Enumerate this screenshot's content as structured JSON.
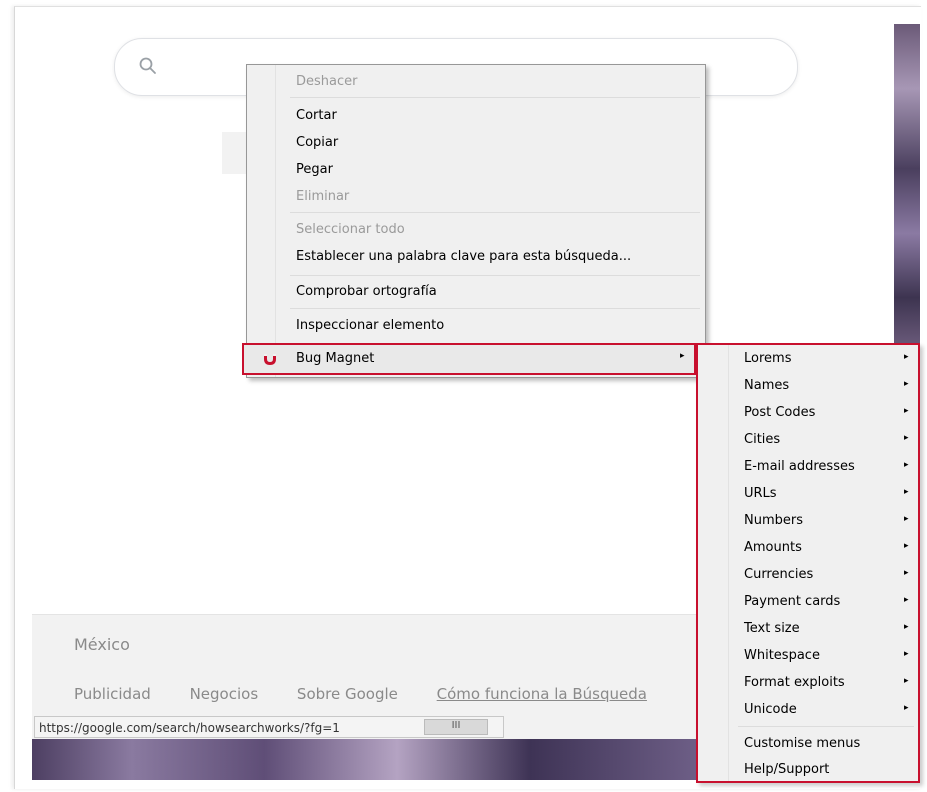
{
  "browser": {
    "status_url": "https://google.com/search/howsearchworks/?fg=1",
    "status_scroll_glyph": "III"
  },
  "google": {
    "footer_country": "México",
    "footer_links": [
      "Publicidad",
      "Negocios",
      "Sobre Google",
      "Cómo funciona la Búsqueda"
    ]
  },
  "context_menu": {
    "items": [
      {
        "label": "Deshacer",
        "enabled": false
      },
      {
        "label": "Cortar",
        "enabled": true
      },
      {
        "label": "Copiar",
        "enabled": true
      },
      {
        "label": "Pegar",
        "enabled": true
      },
      {
        "label": "Eliminar",
        "enabled": false
      },
      {
        "label": "Seleccionar todo",
        "enabled": false
      },
      {
        "label": "Establecer una palabra clave para esta búsqueda...",
        "enabled": true
      },
      {
        "label": "Comprobar ortografía",
        "enabled": true
      },
      {
        "label": "Inspeccionar elemento",
        "enabled": true
      }
    ],
    "extension": {
      "label": "Bug Magnet",
      "icon": "magnet-icon",
      "highlight_color": "#c8102e"
    }
  },
  "submenu": {
    "items": [
      {
        "label": "Lorems"
      },
      {
        "label": "Names"
      },
      {
        "label": "Post Codes"
      },
      {
        "label": "Cities"
      },
      {
        "label": "E-mail addresses"
      },
      {
        "label": "URLs"
      },
      {
        "label": "Numbers"
      },
      {
        "label": "Amounts"
      },
      {
        "label": "Currencies"
      },
      {
        "label": "Payment cards"
      },
      {
        "label": "Text size"
      },
      {
        "label": "Whitespace"
      },
      {
        "label": "Format exploits"
      },
      {
        "label": "Unicode"
      }
    ],
    "footer_items": [
      {
        "label": "Customise menus"
      },
      {
        "label": "Help/Support"
      }
    ],
    "arrow_glyph": "▸"
  }
}
